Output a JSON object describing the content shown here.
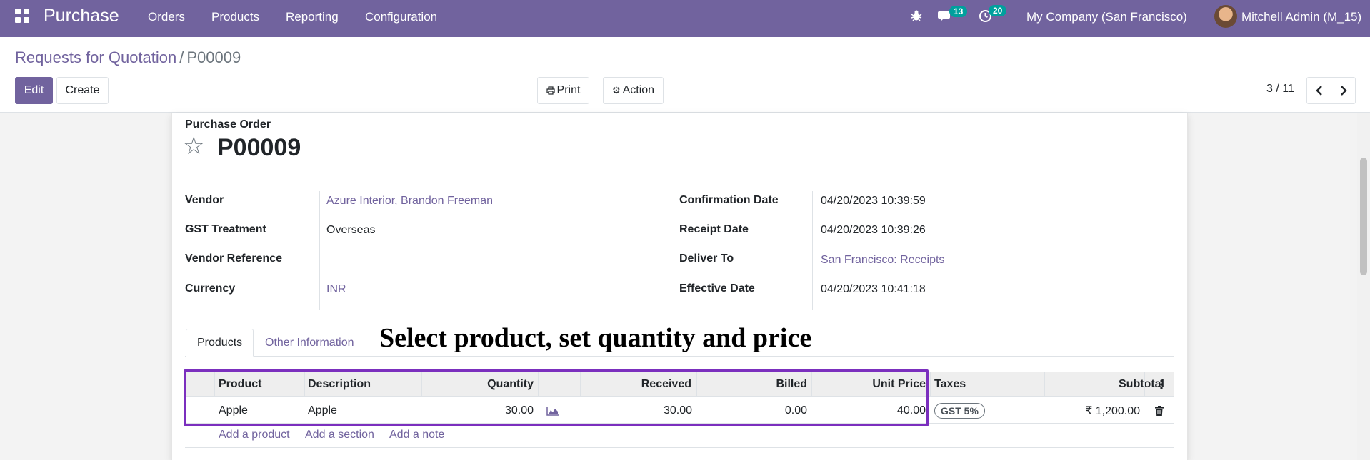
{
  "navbar": {
    "app_name": "Purchase",
    "menu": [
      "Orders",
      "Products",
      "Reporting",
      "Configuration"
    ],
    "messages_count": "13",
    "activities_count": "20",
    "company": "My Company (San Francisco)",
    "user": "Mitchell Admin (M_15)",
    "color": "#71639e"
  },
  "breadcrumb": {
    "parent": "Requests for Quotation",
    "separator": "/",
    "current": "P00009"
  },
  "buttons": {
    "edit": "Edit",
    "create": "Create",
    "print": "Print",
    "action": "Action"
  },
  "pager": {
    "value": "3 / 11"
  },
  "form": {
    "title_label": "Purchase Order",
    "name": "P00009",
    "left_fields": [
      {
        "label": "Vendor",
        "value": "Azure Interior, Brandon Freeman"
      },
      {
        "label": "GST Treatment",
        "value": "Overseas"
      },
      {
        "label": "Vendor Reference",
        "value": ""
      },
      {
        "label": "Currency",
        "value": "INR"
      }
    ],
    "right_fields": [
      {
        "label": "Confirmation Date",
        "value": "04/20/2023 10:39:59"
      },
      {
        "label": "Receipt Date",
        "value": "04/20/2023 10:39:26"
      },
      {
        "label": "Deliver To",
        "value": "San Francisco: Receipts"
      },
      {
        "label": "Effective Date",
        "value": "04/20/2023 10:41:18"
      }
    ]
  },
  "tabs": [
    "Products",
    "Other Information"
  ],
  "annotation": "Select product, set quantity and price",
  "table": {
    "headers": {
      "product": "Product",
      "description": "Description",
      "quantity": "Quantity",
      "received": "Received",
      "billed": "Billed",
      "unit_price": "Unit Price",
      "taxes": "Taxes",
      "subtotal": "Subtotal"
    },
    "rows": [
      {
        "product": "Apple",
        "description": "Apple",
        "quantity": "30.00",
        "received": "30.00",
        "billed": "0.00",
        "unit_price": "40.00",
        "tax": "GST 5%",
        "subtotal": "₹ 1,200.00"
      }
    ],
    "add_links": [
      "Add a product",
      "Add a section",
      "Add a note"
    ]
  },
  "icons": {
    "apps": "apps-grid-icon",
    "bug": "bug-icon",
    "chat": "chat-icon",
    "activity": "clock-icon",
    "print": "print-icon",
    "gear": "gear-icon",
    "star": "star-icon",
    "forecast": "area-chart-icon",
    "trash": "trash-icon",
    "kebab": "kebab-menu-icon"
  },
  "highlight_color": "#7b2fbe"
}
